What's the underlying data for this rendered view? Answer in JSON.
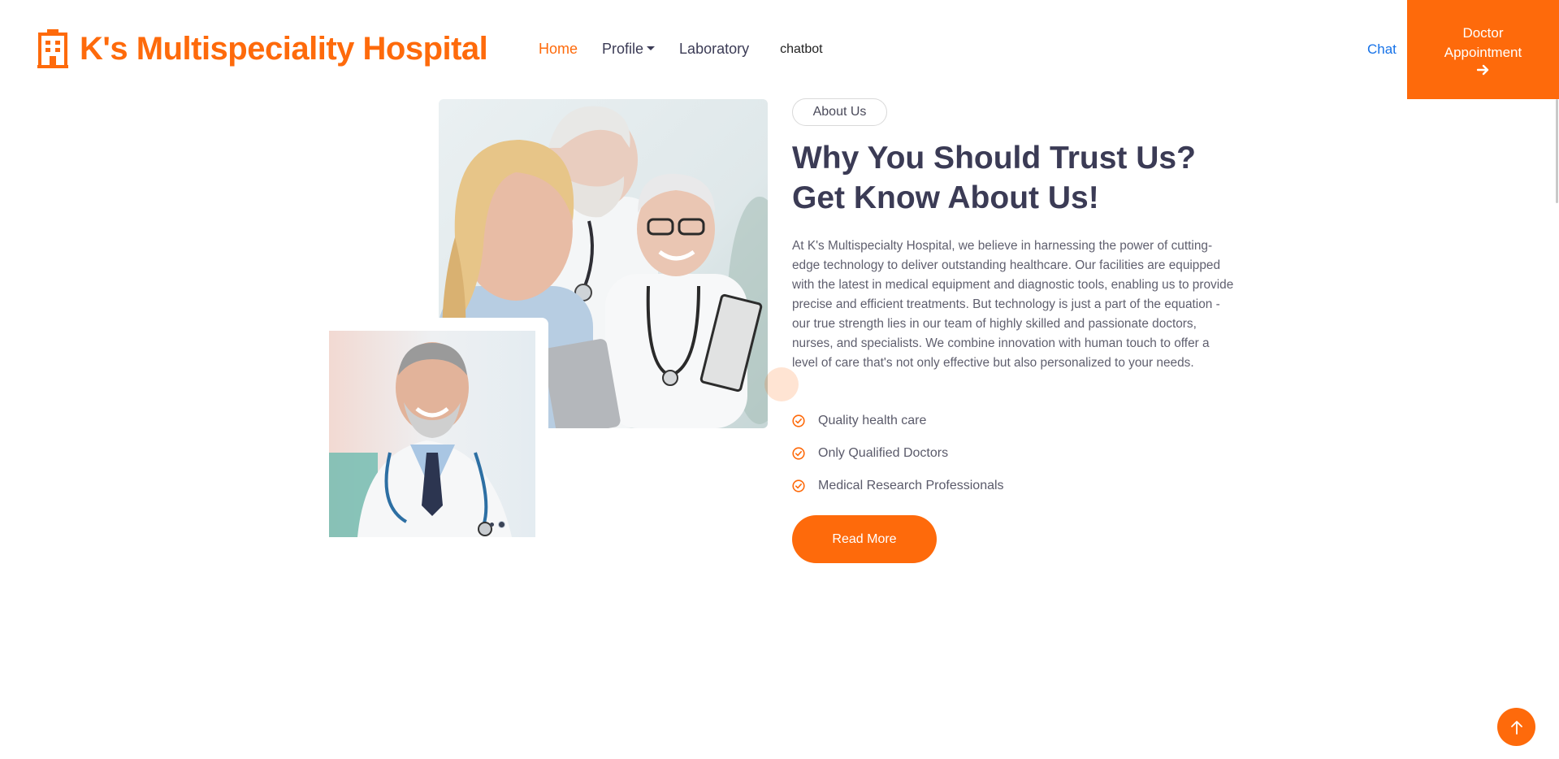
{
  "brand": {
    "name": "K's Multispeciality Hospital",
    "icon": "hospital-building-icon"
  },
  "nav": {
    "items": [
      {
        "label": "Home",
        "active": true
      },
      {
        "label": "Profile",
        "dropdown": true
      },
      {
        "label": "Laboratory"
      },
      {
        "label": "chatbot"
      }
    ],
    "chat_label": "Chat",
    "appointment_label_line1": "Doctor",
    "appointment_label_line2": "Appointment",
    "appointment_icon": "arrow-right-icon"
  },
  "about": {
    "tag": "About Us",
    "heading_line1": "Why You Should Trust Us?",
    "heading_line2": "Get Know About Us!",
    "paragraph": "At K's Multispecialty Hospital, we believe in harnessing the power of cutting-edge technology to deliver outstanding healthcare. Our facilities are equipped with the latest in medical equipment and diagnostic tools, enabling us to provide precise and efficient treatments. But technology is just a part of the equation - our true strength lies in our team of highly skilled and passionate doctors, nurses, and specialists. We combine innovation with human touch to offer a level of care that's not only effective but also personalized to your needs.",
    "features": [
      "Quality health care",
      "Only Qualified Doctors",
      "Medical Research Professionals"
    ],
    "read_more": "Read More"
  },
  "colors": {
    "accent": "#fe6a0b",
    "heading": "#3b3b55",
    "link": "#1672e8"
  },
  "back_to_top_icon": "arrow-up-icon"
}
